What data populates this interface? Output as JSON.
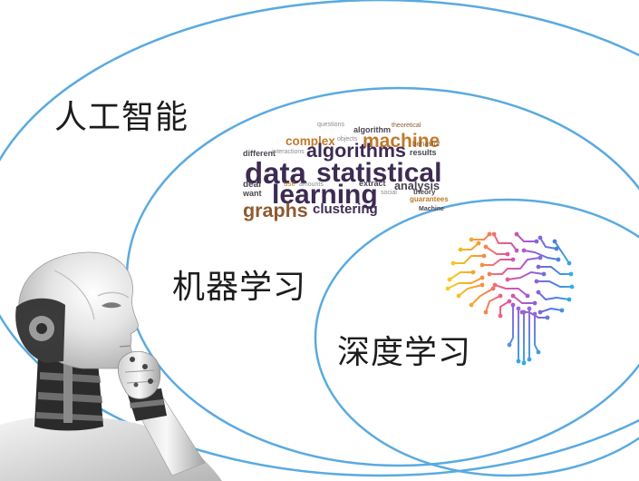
{
  "diagram": {
    "ellipse_color": "#5aaae0",
    "labels": {
      "artificial_intelligence": "人工智能",
      "machine_learning": "机器学习",
      "deep_learning": "深度学习"
    }
  },
  "wordcloud": {
    "words": [
      "questions",
      "theoretical",
      "algorithm",
      "complex",
      "objects",
      "machine",
      "behavior",
      "different",
      "interactions",
      "algorithms",
      "results",
      "data",
      "statistical",
      "deal",
      "use",
      "amounts",
      "extract",
      "analysis",
      "want",
      "learning",
      "social",
      "theory",
      "guarantees",
      "graphs",
      "clustering",
      "Machine"
    ],
    "colors": {
      "primary": "#3d2b52",
      "accent": "#c07a2c",
      "secondary": "#8e5a30",
      "muted": "#8c8c8c",
      "dark": "#4a4550"
    }
  },
  "icons": {
    "robot": "robot-icon",
    "brain": "circuit-brain-icon"
  }
}
